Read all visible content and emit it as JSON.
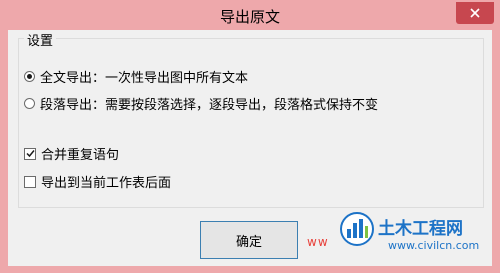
{
  "window": {
    "title": "导出原文",
    "close_icon": "close-icon"
  },
  "group": {
    "legend": "设置",
    "options": [
      {
        "label": "全文导出：一次性导出图中所有文本",
        "selected": true
      },
      {
        "label": "段落导出：需要按段落选择，逐段导出，段落格式保持不变",
        "selected": false
      }
    ],
    "checkboxes": [
      {
        "label": "合并重复语句",
        "checked": true
      },
      {
        "label": "导出到当前工作表后面",
        "checked": false
      }
    ]
  },
  "buttons": {
    "ok_label": "确定"
  },
  "watermark": {
    "prefix": "ww",
    "site_name": "土木工程网",
    "url": "www.civilcn.com"
  },
  "colors": {
    "titlebar": "#eea8ab",
    "close_button": "#c7474f",
    "client_bg": "#f0f0f0",
    "watermark_blue": "#1d73c7"
  }
}
